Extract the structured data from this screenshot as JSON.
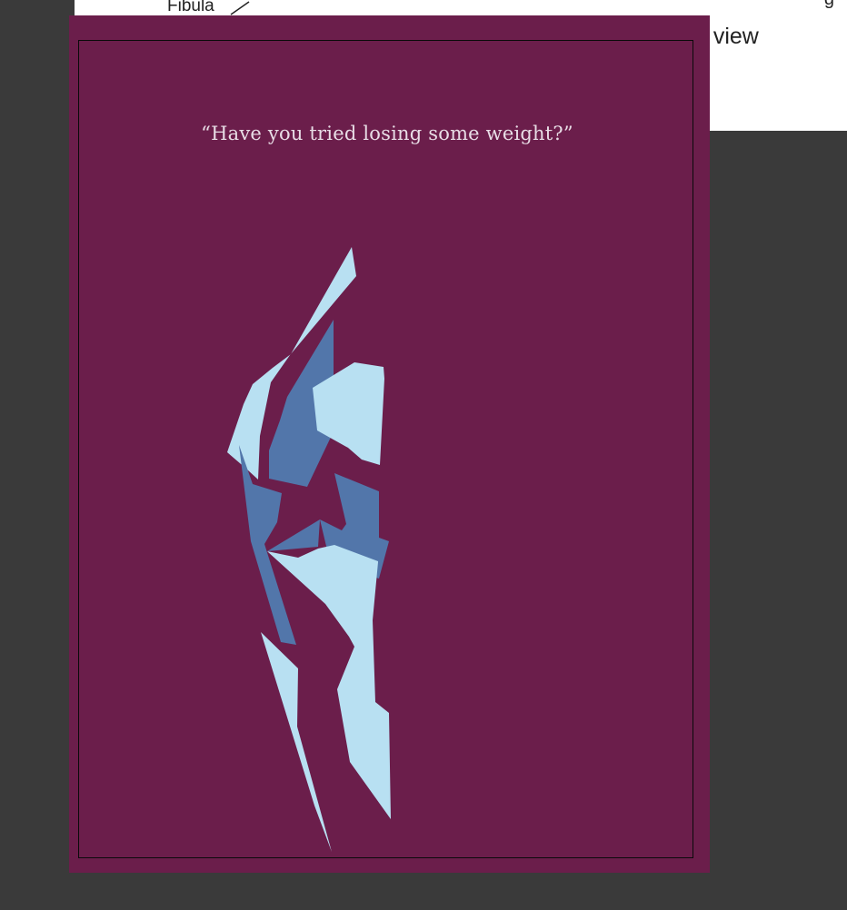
{
  "background_document": {
    "fibula_label": "Fibula",
    "view_label": "e view",
    "corner_mark": "g"
  },
  "poster": {
    "quote": "“Have you tried losing some weight?”",
    "colors": {
      "card": "#6b1e4b",
      "frame": "#0a0a0a",
      "quote_text": "#e8dde6",
      "shape_light": "#b8e0f2",
      "shape_dark": "#5276aa"
    },
    "illustration": "abstract-knee-joint"
  }
}
